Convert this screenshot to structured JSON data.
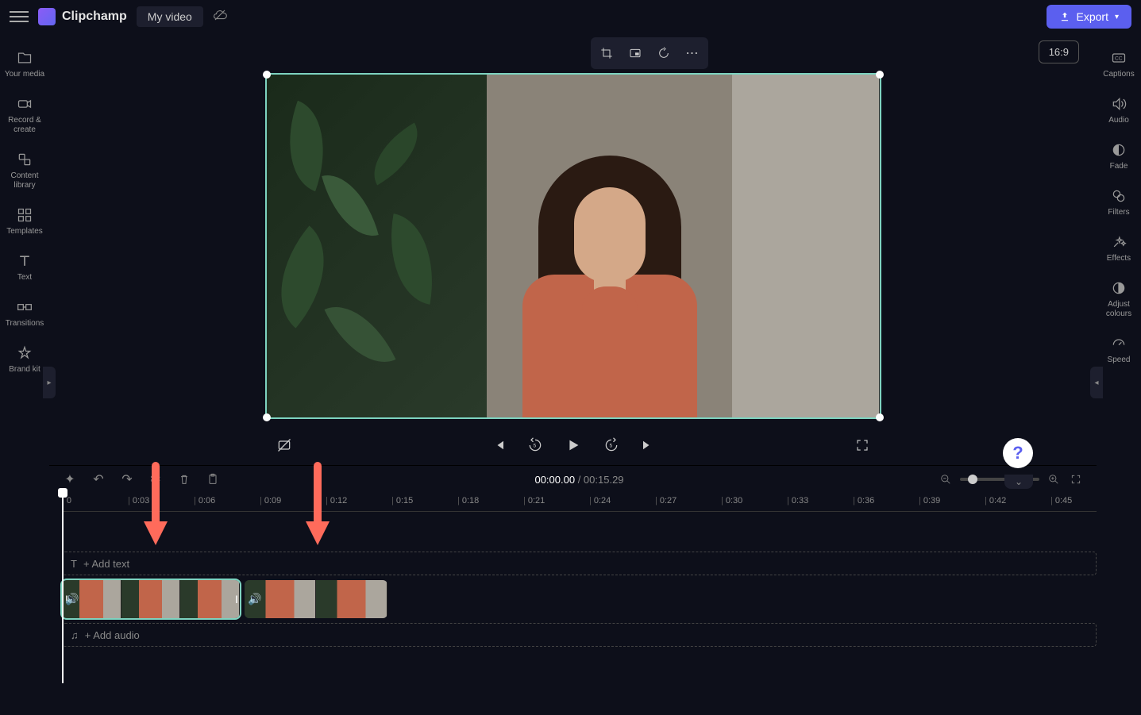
{
  "header": {
    "app_name": "Clipchamp",
    "project_name": "My video",
    "export_label": "Export"
  },
  "left_sidebar": {
    "items": [
      {
        "label": "Your media",
        "icon": "folder"
      },
      {
        "label": "Record & create",
        "icon": "camera"
      },
      {
        "label": "Content library",
        "icon": "library"
      },
      {
        "label": "Templates",
        "icon": "templates"
      },
      {
        "label": "Text",
        "icon": "text"
      },
      {
        "label": "Transitions",
        "icon": "transitions"
      },
      {
        "label": "Brand kit",
        "icon": "brandkit"
      }
    ]
  },
  "right_sidebar": {
    "items": [
      {
        "label": "Captions",
        "icon": "cc"
      },
      {
        "label": "Audio",
        "icon": "speaker"
      },
      {
        "label": "Fade",
        "icon": "fade"
      },
      {
        "label": "Filters",
        "icon": "filters"
      },
      {
        "label": "Effects",
        "icon": "effects"
      },
      {
        "label": "Adjust colours",
        "icon": "adjust"
      },
      {
        "label": "Speed",
        "icon": "speed"
      }
    ]
  },
  "preview": {
    "aspect_ratio": "16:9"
  },
  "playback": {
    "current_time": "00:00.00",
    "total_time": "00:15.29"
  },
  "ruler": {
    "ticks": [
      "0",
      "0:03",
      "0:06",
      "0:09",
      "0:12",
      "0:15",
      "0:18",
      "0:21",
      "0:24",
      "0:27",
      "0:30",
      "0:33",
      "0:36",
      "0:39",
      "0:42",
      "0:45"
    ]
  },
  "tracks": {
    "text_placeholder": "+ Add text",
    "audio_placeholder": "+ Add audio"
  }
}
